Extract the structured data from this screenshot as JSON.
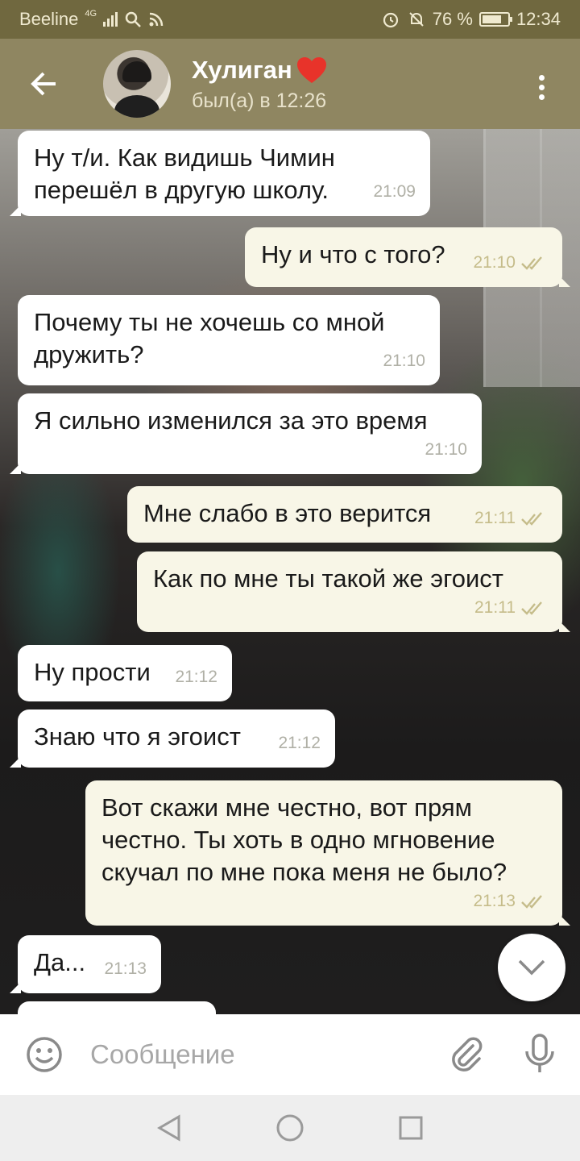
{
  "status_bar": {
    "carrier": "Beeline",
    "network": "4G",
    "battery_percent": "76 %",
    "battery_level": 0.76,
    "time": "12:34"
  },
  "header": {
    "contact_name": "Хулиган",
    "last_seen": "был(а) в 12:26",
    "icons": [
      "back-arrow-icon",
      "heart-icon",
      "more-vert-icon"
    ]
  },
  "messages": [
    {
      "dir": "in",
      "text": "Ну т/и. Как видишь Чимин\nперешёл в другую школу.",
      "time": "21:09"
    },
    {
      "dir": "out",
      "text": "Ну и что с того?",
      "time": "21:10"
    },
    {
      "dir": "in",
      "text": "Почему ты не хочешь со мной\nдружить?",
      "time": "21:10"
    },
    {
      "dir": "in",
      "text": "Я сильно изменился за это время",
      "time": "21:10"
    },
    {
      "dir": "out",
      "text": "Мне слабо в это верится",
      "time": "21:11"
    },
    {
      "dir": "out",
      "text": "Как по мне ты такой же эгоист",
      "time": "21:11"
    },
    {
      "dir": "in",
      "text": "Ну прости",
      "time": "21:12"
    },
    {
      "dir": "in",
      "text": "Знаю что я эгоист",
      "time": "21:12"
    },
    {
      "dir": "out",
      "text": "Вот скажи мне честно, вот прям\nчестно. Ты хоть в одно мгновение\nскучал по мне пока меня не было?",
      "time": "21:13"
    },
    {
      "dir": "in",
      "text": "Да...",
      "time": "21:13"
    }
  ],
  "composer": {
    "placeholder": "Сообщение"
  },
  "colors": {
    "header_bg": "#8f8661",
    "status_bg": "#70683f",
    "incoming_bubble": "#ffffff",
    "outgoing_bubble": "#f8f6e7",
    "read_ticks": "#c5bc8a"
  }
}
